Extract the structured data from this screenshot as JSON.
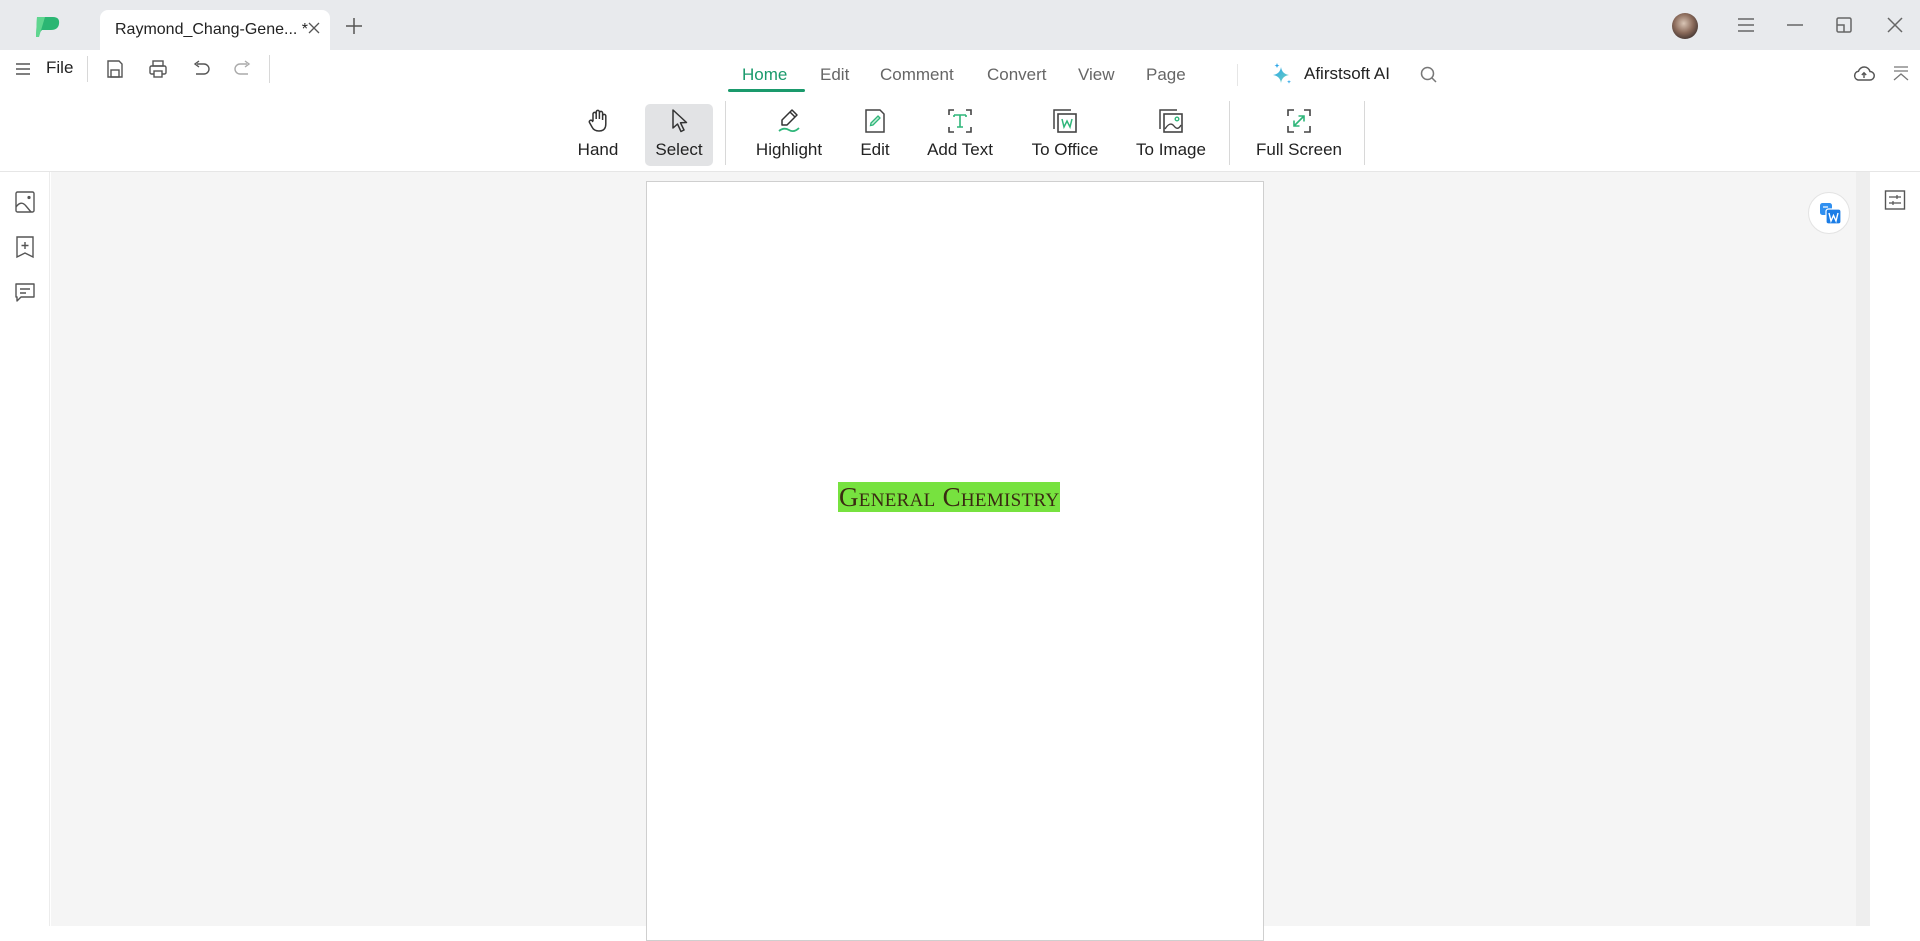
{
  "window": {
    "tab_title": "Raymond_Chang-Gene... *",
    "icons": {
      "logo": "app-logo-icon",
      "close_tab": "close-icon",
      "new_tab": "plus-icon",
      "avatar": "user-avatar",
      "menu": "hamburger-icon",
      "minimize": "minimize-icon",
      "restore": "restore-icon",
      "close": "close-icon"
    }
  },
  "menubar": {
    "file_label": "File",
    "quick_actions": [
      "save-icon",
      "print-icon",
      "undo-icon",
      "redo-icon"
    ],
    "tabs": [
      {
        "label": "Home",
        "active": true
      },
      {
        "label": "Edit",
        "active": false
      },
      {
        "label": "Comment",
        "active": false
      },
      {
        "label": "Convert",
        "active": false
      },
      {
        "label": "View",
        "active": false
      },
      {
        "label": "Page",
        "active": false
      }
    ],
    "ai_label": "Afirstsoft AI",
    "right_icons": [
      "cloud-upload-icon",
      "collapse-ribbon-icon"
    ]
  },
  "toolbar": {
    "tools": [
      {
        "label": "Hand",
        "icon": "hand-icon",
        "active": false
      },
      {
        "label": "Select",
        "icon": "cursor-icon",
        "active": true
      },
      {
        "label": "Highlight",
        "icon": "highlight-pen-icon",
        "active": false
      },
      {
        "label": "Edit",
        "icon": "edit-document-icon",
        "active": false
      },
      {
        "label": "Add Text",
        "icon": "add-text-icon",
        "active": false
      },
      {
        "label": "To Office",
        "icon": "to-office-icon",
        "active": false
      },
      {
        "label": "To Image",
        "icon": "to-image-icon",
        "active": false
      },
      {
        "label": "Full Screen",
        "icon": "full-screen-icon",
        "active": false
      }
    ]
  },
  "left_sidebar": {
    "items": [
      "thumbnail-icon",
      "bookmark-add-icon",
      "comment-list-icon"
    ]
  },
  "right_sidebar": {
    "items": [
      "properties-panel-icon"
    ],
    "floating": "translate-icon"
  },
  "document": {
    "title_text": "General Chemistry",
    "highlight_color": "#77e23f"
  },
  "colors": {
    "accent": "#1a9a6c",
    "titlebar_bg": "#e8eaed",
    "canvas_bg": "#f5f5f5"
  }
}
